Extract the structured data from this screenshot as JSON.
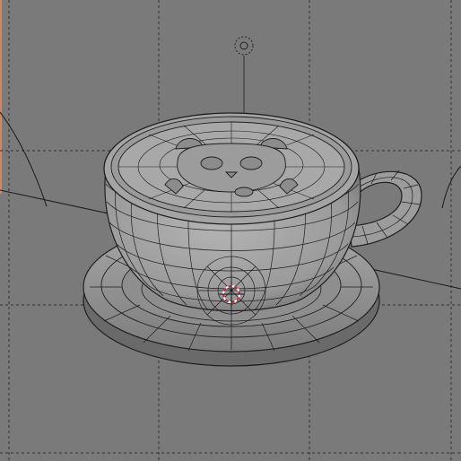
{
  "viewport": {
    "view": "perspective",
    "background": "#7a7a7a",
    "guide_line_color": "#3a3a3a",
    "mesh_fill": "#9a9a9a",
    "mesh_wire": "#1e1e1e",
    "cursor_color": "#c0303a"
  },
  "scene": {
    "objects": [
      "saucer",
      "cup",
      "handle",
      "latte-art"
    ],
    "icons": [
      "lamp-icon",
      "3d-cursor-icon",
      "camera-frame-lines"
    ]
  }
}
